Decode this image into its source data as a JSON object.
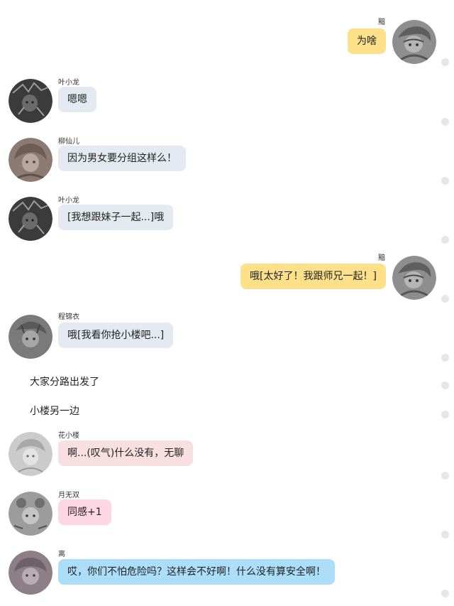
{
  "colors": {
    "bubble_me": "#fce08a",
    "bubble_gray": "#e4e9f2",
    "bubble_pink_soft": "#f7dfe2",
    "bubble_pink": "#ffd6e3",
    "bubble_blue": "#acdef9",
    "scroll_dot": "#e6e6e6"
  },
  "messages": [
    {
      "sender": "黯",
      "text": "为啥",
      "side": "right",
      "bubble_color": "#fce08a",
      "avatar_icon": "sketch-avatar-an-icon"
    },
    {
      "sender": "叶小龙",
      "text": "嗯嗯",
      "side": "left",
      "bubble_color": "#e4e9f2",
      "avatar_icon": "sketch-avatar-ye-xiaolong-icon"
    },
    {
      "sender": "柳仙儿",
      "text": "因为男女要分组这样么！",
      "side": "left",
      "bubble_color": "#e4e9f2",
      "avatar_icon": "sketch-avatar-liu-xianer-icon"
    },
    {
      "sender": "叶小龙",
      "text": "[我想跟妹子一起...]哦",
      "side": "left",
      "bubble_color": "#e4e9f2",
      "avatar_icon": "sketch-avatar-ye-xiaolong-icon"
    },
    {
      "sender": "黯",
      "text": "哦[太好了！我跟师兄一起！]",
      "side": "right",
      "bubble_color": "#fce08a",
      "avatar_icon": "sketch-avatar-an-icon"
    },
    {
      "sender": "程锦衣",
      "text": "哦[我看你抢小楼吧...]",
      "side": "left",
      "bubble_color": "#e4e9f2",
      "avatar_icon": "sketch-avatar-cheng-jinyi-icon"
    },
    {
      "sender": "花小楼",
      "text": "啊...(叹气)什么没有，无聊",
      "side": "left",
      "bubble_color": "#f7dfe2",
      "avatar_icon": "sketch-avatar-hua-xiaolou-icon"
    },
    {
      "sender": "月无双",
      "text": "同感+1",
      "side": "left",
      "bubble_color": "#ffd6e3",
      "avatar_icon": "sketch-avatar-yue-wushuang-icon"
    },
    {
      "sender": "离",
      "text": "哎，你们不怕危险吗？这样会不好啊！什么没有算安全啊！",
      "side": "left",
      "bubble_color": "#acdef9",
      "avatar_icon": "sketch-avatar-li-icon"
    }
  ],
  "narration": [
    "大家分路出发了",
    "小楼另一边"
  ]
}
